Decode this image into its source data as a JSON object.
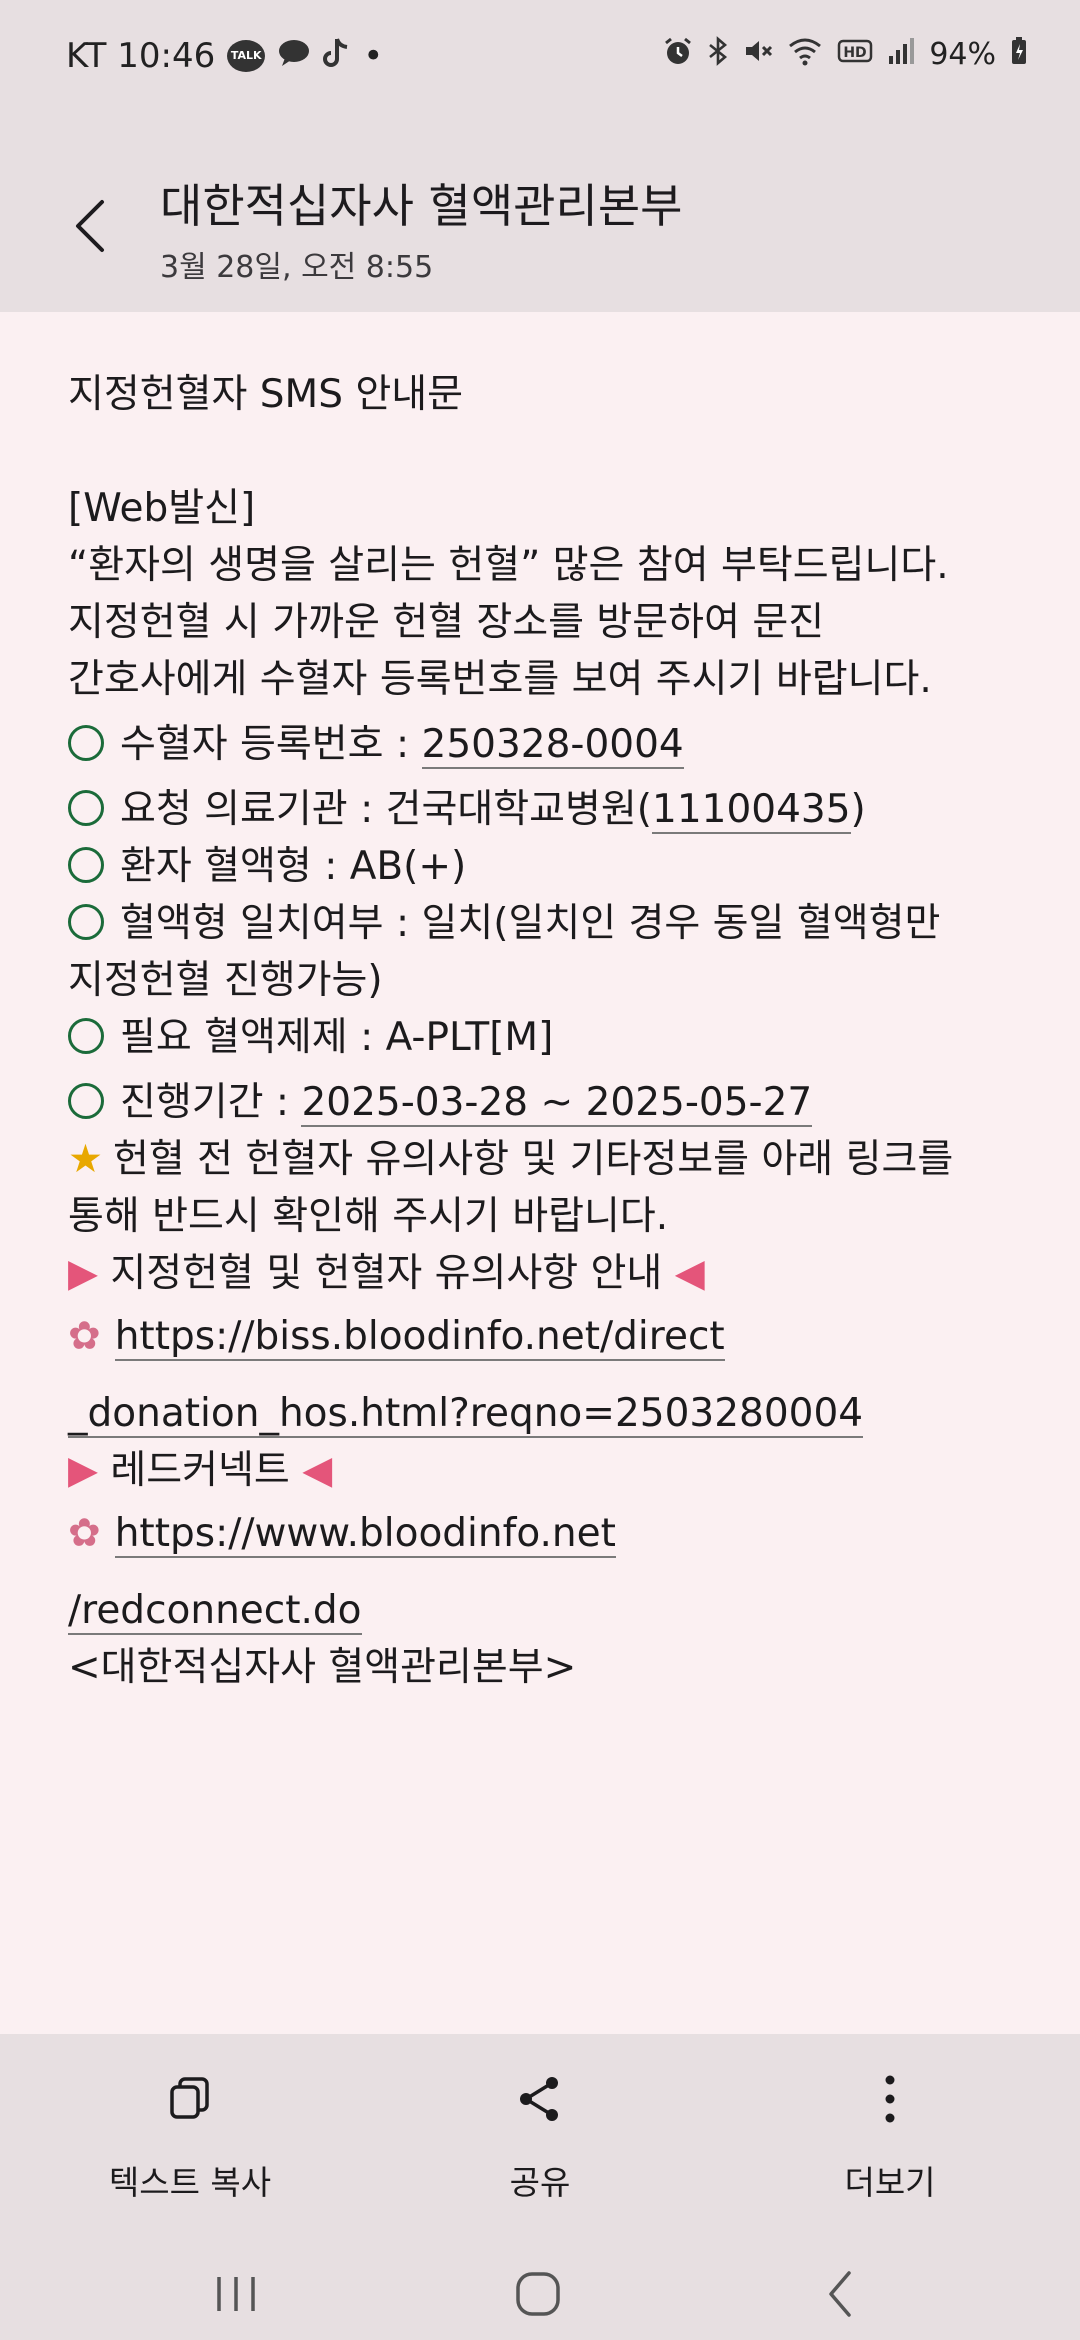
{
  "status_bar": {
    "carrier_time": "KT 10:46",
    "kakao_badge": "TALK",
    "dot": "•",
    "battery": "94%"
  },
  "header": {
    "title": "대한적십자사 혈액관리본부",
    "subtitle": "3월 28일, 오전 8:55"
  },
  "message": {
    "heading": "지정헌혈자 SMS 안내문",
    "tag": "[Web발신]",
    "intro_lines": [
      "“환자의 생명을 살리는 헌혈” 많은 참여 부탁드립니다.",
      "지정헌혈 시 가까운 헌혈 장소를 방문하여 문진",
      "간호사에게 수혈자 등록번호를 보여 주시기 바랍니다."
    ],
    "reg_label": "수혈자 등록번호 : ",
    "reg_value": "250328-0004",
    "hospital_label": "요청 의료기관 : 건국대학교병원(",
    "hospital_code": "11100435",
    "hospital_close": ")",
    "blood_type": "환자 혈액형 : AB(+)",
    "match_line1": "혈액형 일치여부 : 일치(일치인 경우 동일 혈액형만",
    "match_line2": "지정헌혈 진행가능)",
    "product": "필요 혈액제제 : A-PLT[M]",
    "period_label": "진행기간 : ",
    "period_value": "2025-03-28 ~ 2025-05-27",
    "notice_line1": "헌혈 전 헌혈자 유의사항 및 기타정보를 아래 링크를",
    "notice_line2": "통해 반드시 확인해 주시기 바랍니다.",
    "section1": " 지정헌혈 및 헌혈자 유의사항 안내 ",
    "link1_part1": "https://biss.bloodinfo.net/direct",
    "link1_part2": "_donation_hos.html?reqno=2503280004",
    "section2": " 레드커넥트 ",
    "link2_part1": "https://www.bloodinfo.net",
    "link2_part2": "/redconnect.do",
    "signature": "<대한적십자사 혈액관리본부>"
  },
  "actions": {
    "copy": "텍스트 복사",
    "share": "공유",
    "more": "더보기"
  }
}
